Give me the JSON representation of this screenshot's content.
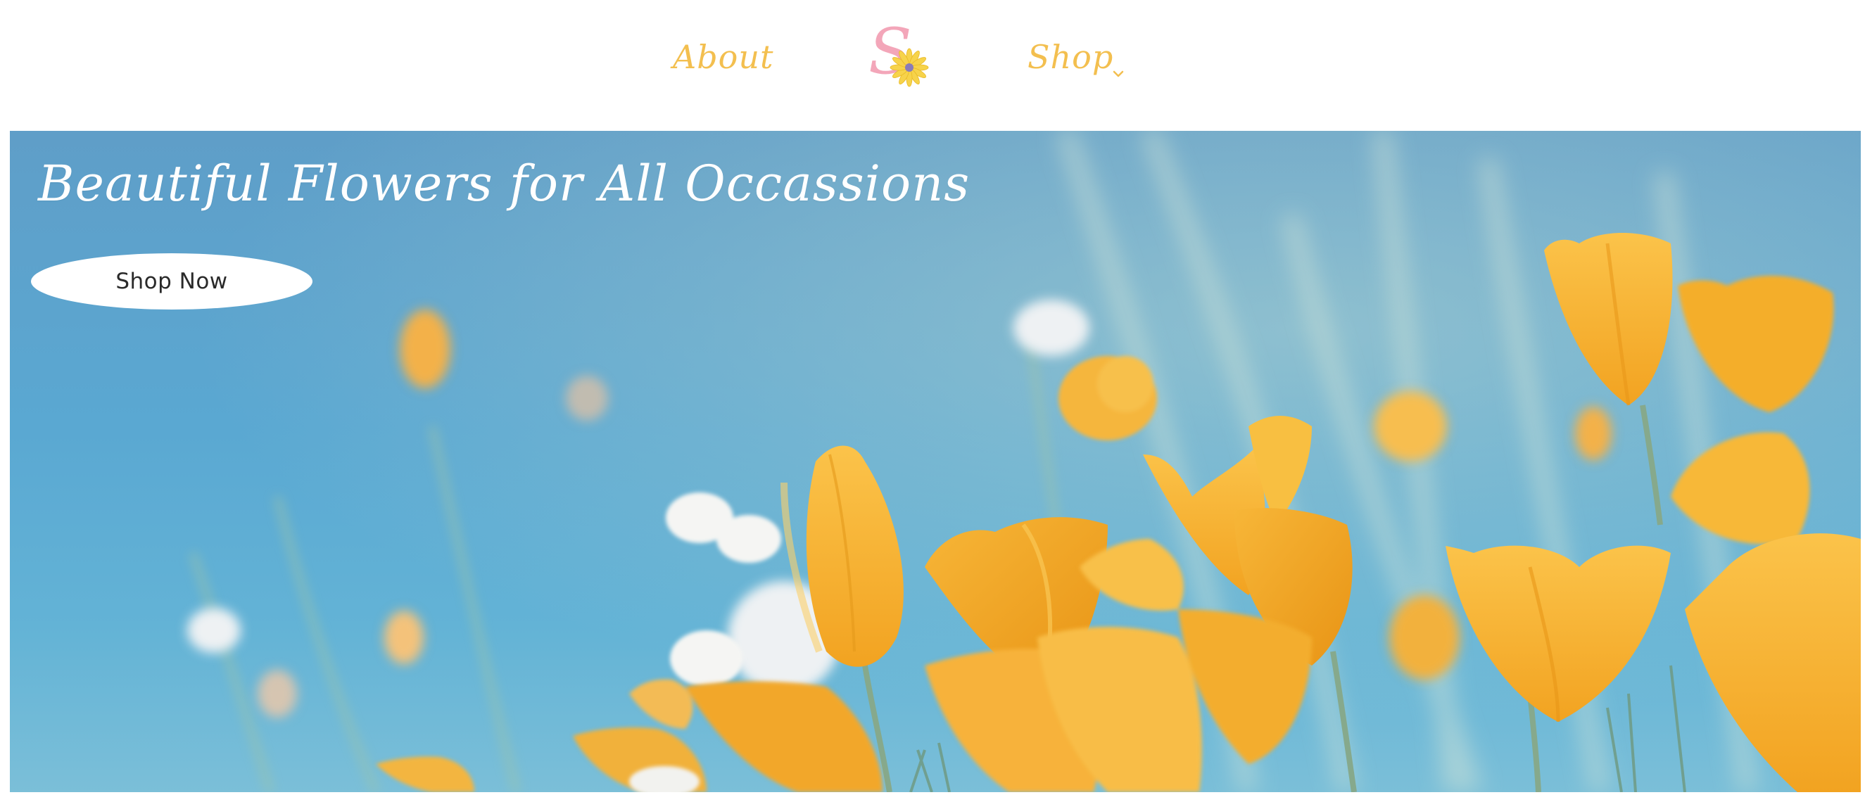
{
  "nav": {
    "about_label": "About",
    "shop_label": "Shop",
    "logo_letter": "S"
  },
  "hero": {
    "title": "Beautiful Flowers for All Occassions",
    "cta_label": "Shop Now"
  },
  "colors": {
    "nav_text": "#f3bf4f",
    "logo_pink": "#f3a6b9",
    "logo_flower": "#f7d34a",
    "sky": "#5aa8d2",
    "poppy": "#f6b12f",
    "hero_text": "#ffffff"
  },
  "icons": {
    "logo": "logo-flower-icon",
    "shop_dropdown": "chevron-down-icon"
  }
}
